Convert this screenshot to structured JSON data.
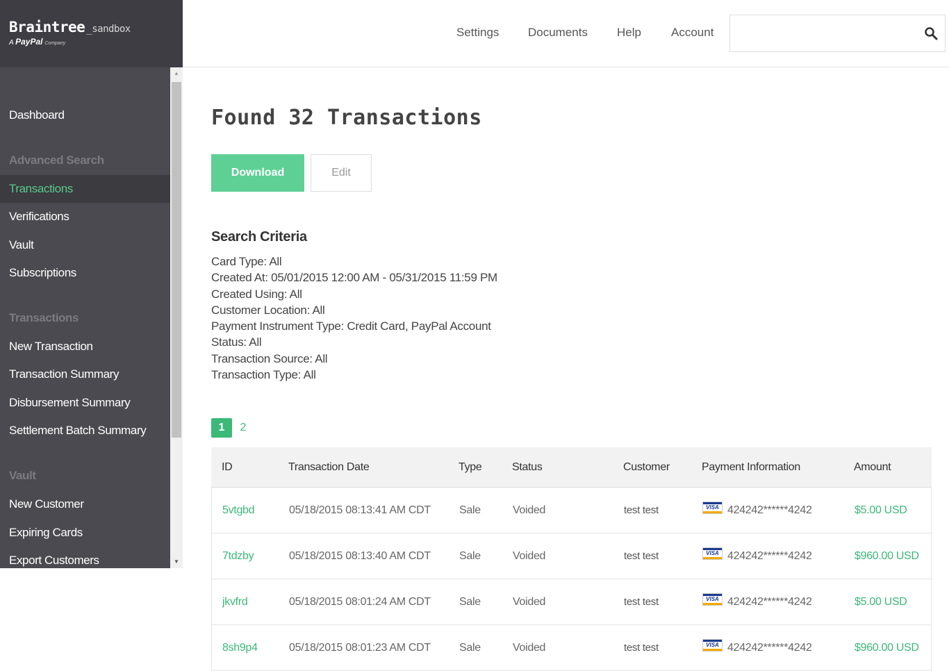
{
  "brand": {
    "name": "Braintree",
    "env": "_sandbox",
    "tag_prefix": "A",
    "tag_brand": "PayPal",
    "tag_suffix": "Company"
  },
  "topnav": {
    "settings": "Settings",
    "documents": "Documents",
    "help": "Help",
    "account": "Account",
    "search_value": ""
  },
  "sidebar": {
    "items": [
      {
        "label": "Dashboard",
        "type": "link"
      },
      {
        "label": "Advanced Search",
        "type": "heading"
      },
      {
        "label": "Transactions",
        "type": "active"
      },
      {
        "label": "Verifications",
        "type": "link"
      },
      {
        "label": "Vault",
        "type": "link"
      },
      {
        "label": "Subscriptions",
        "type": "link"
      },
      {
        "label": "Transactions",
        "type": "heading"
      },
      {
        "label": "New Transaction",
        "type": "link"
      },
      {
        "label": "Transaction Summary",
        "type": "link"
      },
      {
        "label": "Disbursement Summary",
        "type": "link"
      },
      {
        "label": "Settlement Batch Summary",
        "type": "link"
      },
      {
        "label": "Vault",
        "type": "heading"
      },
      {
        "label": "New Customer",
        "type": "link"
      },
      {
        "label": "Expiring Cards",
        "type": "link"
      },
      {
        "label": "Export Customers",
        "type": "link"
      }
    ]
  },
  "main": {
    "title": "Found 32 Transactions",
    "download_label": "Download",
    "edit_label": "Edit",
    "criteria_title": "Search Criteria",
    "criteria": [
      "Card Type: All",
      "Created At: 05/01/2015 12:00 AM - 05/31/2015 11:59 PM",
      "Created Using: All",
      "Customer Location: All",
      "Payment Instrument Type: Credit Card, PayPal Account",
      "Status: All",
      "Transaction Source: All",
      "Transaction Type: All"
    ],
    "pagination": {
      "current": "1",
      "other": "2"
    }
  },
  "table": {
    "headers": {
      "id": "ID",
      "date": "Transaction Date",
      "type": "Type",
      "status": "Status",
      "customer": "Customer",
      "payment": "Payment Information",
      "amount": "Amount"
    },
    "rows": [
      {
        "id": "5vtgbd",
        "date": "05/18/2015 08:13:41 AM CDT",
        "type": "Sale",
        "status": "Voided",
        "customer": "test test",
        "card_brand": "VISA",
        "card": "424242******4242",
        "amount": "$5.00 USD"
      },
      {
        "id": "7tdzby",
        "date": "05/18/2015 08:13:40 AM CDT",
        "type": "Sale",
        "status": "Voided",
        "customer": "test test",
        "card_brand": "VISA",
        "card": "424242******4242",
        "amount": "$960.00 USD"
      },
      {
        "id": "jkvfrd",
        "date": "05/18/2015 08:01:24 AM CDT",
        "type": "Sale",
        "status": "Voided",
        "customer": "test test",
        "card_brand": "VISA",
        "card": "424242******4242",
        "amount": "$5.00 USD"
      },
      {
        "id": "8sh9p4",
        "date": "05/18/2015 08:01:23 AM CDT",
        "type": "Sale",
        "status": "Voided",
        "customer": "test test",
        "card_brand": "VISA",
        "card": "424242******4242",
        "amount": "$960.00 USD"
      }
    ]
  },
  "colors": {
    "accent": "#3cb878",
    "download_button": "#5fd095",
    "sidebar_bg": "#4a4a50",
    "brand_bg": "#3e3d43"
  }
}
